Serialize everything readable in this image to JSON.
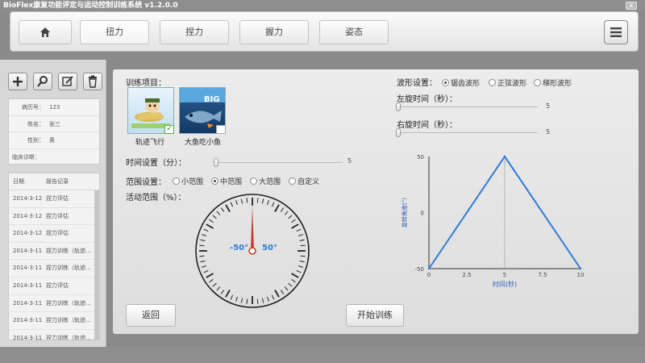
{
  "window": {
    "title": "BioFlex康复功能评定与运动控制训练系统 v1.2.0.0",
    "close": "x"
  },
  "nav": {
    "tabs": [
      "扭力",
      "捏力",
      "握力",
      "姿态"
    ],
    "active_tab": 0
  },
  "sidebar": {
    "patient": {
      "rows": [
        {
          "label": "病历号：",
          "value": "123"
        },
        {
          "label": "姓名：",
          "value": "张三"
        },
        {
          "label": "性别：",
          "value": "男"
        },
        {
          "label": "临床诊断：",
          "value": ""
        }
      ]
    },
    "records": {
      "header": {
        "date": "日期",
        "record": "报告记录"
      },
      "items": [
        {
          "date": "2014-3-12",
          "record": "捏力评估"
        },
        {
          "date": "2014-3-12",
          "record": "捏力评估"
        },
        {
          "date": "2014-3-12",
          "record": "捏力评估"
        },
        {
          "date": "2014-3-11",
          "record": "捏力训练（轨迹..."
        },
        {
          "date": "2014-3-11",
          "record": "捏力训练（轨迹..."
        },
        {
          "date": "2014-3-11",
          "record": "捏力评估"
        },
        {
          "date": "2014-3-11",
          "record": "捏力训练（轨迹..."
        },
        {
          "date": "2014-3-11",
          "record": "捏力训练（轨迹..."
        },
        {
          "date": "2014-3-11",
          "record": "捏力训练（轨迹..."
        }
      ]
    }
  },
  "training": {
    "label": "训练项目：",
    "items": [
      {
        "caption": "轨迹飞行",
        "checked": true
      },
      {
        "caption": "大鱼吃小鱼",
        "checked": false
      }
    ],
    "thumb2_text": "BIG"
  },
  "time_setting": {
    "label": "时间设置（分）：",
    "value": "5",
    "fraction": 0.0
  },
  "range_setting": {
    "label": "范围设置：",
    "options": [
      "小范围",
      "中范围",
      "大范围",
      "自定义"
    ],
    "selected": 1
  },
  "activity_range": {
    "label": "活动范围（%）：",
    "left": "-50°",
    "right": "50°"
  },
  "wave": {
    "label": "波形设置：",
    "options": [
      "锯齿波形",
      "正弦波形",
      "梯形波形"
    ],
    "selected": 0,
    "left_label": "左旋时间（秒）：",
    "left_value": "5",
    "right_label": "右旋时间（秒）：",
    "right_value": "5"
  },
  "buttons": {
    "back": "返回",
    "start": "开始训练"
  },
  "chart_data": {
    "type": "line",
    "x": [
      0,
      5,
      10
    ],
    "y": [
      -50,
      50,
      -50
    ],
    "xlabel": "时间(秒)",
    "ylabel": "旋转角度(°)",
    "xlim": [
      0,
      10
    ],
    "ylim": [
      -50,
      50
    ],
    "xticks": [
      "0",
      "2.5",
      "5",
      "7.5",
      "10"
    ],
    "yticks": [
      "50",
      "0",
      "-50"
    ],
    "series_color": "#2f7bd8"
  },
  "colors": {
    "accent_blue": "#2a7bd6",
    "needle": "#c0392b"
  }
}
